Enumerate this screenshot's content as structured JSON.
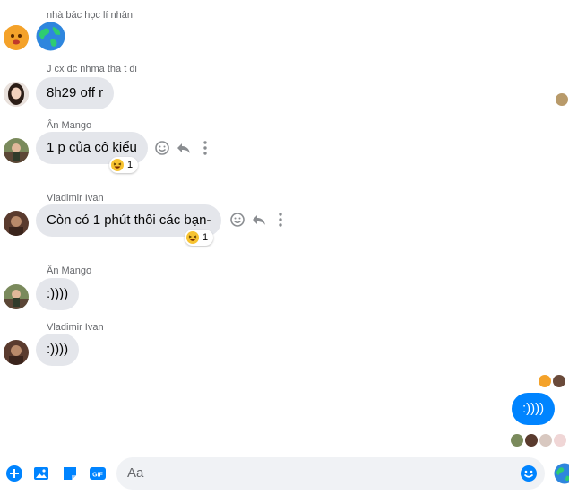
{
  "messages": [
    {
      "sender": "nhà bác học lí nhân",
      "text": "",
      "avatar": "orange-face-avatar",
      "emoji": "globe-icon"
    },
    {
      "sender": "J cx đc nhma tha t đi",
      "text": "8h29 off r",
      "avatar": "girl-avatar"
    },
    {
      "sender": "Ân Mango",
      "text": "1 p của cô kiểu",
      "avatar": "outdoor-avatar",
      "reaction_count": "1"
    },
    {
      "sender": "Vladimir Ivan",
      "text": "Còn có 1 phút thôi các bạn-",
      "avatar": "dark-avatar",
      "reaction_count": "1"
    },
    {
      "sender": "Ân Mango",
      "text": ":))))",
      "avatar": "outdoor-avatar"
    },
    {
      "sender": "Vladimir Ivan",
      "text": ":))))",
      "avatar": "dark-avatar"
    }
  ],
  "my_message": {
    "text": ":))))",
    "color": "#0084ff"
  },
  "composer": {
    "placeholder": "Aa",
    "gif_label": "GIF"
  },
  "colors": {
    "accent": "#0084ff",
    "bubble": "#e4e6eb",
    "meta": "#65676b"
  }
}
